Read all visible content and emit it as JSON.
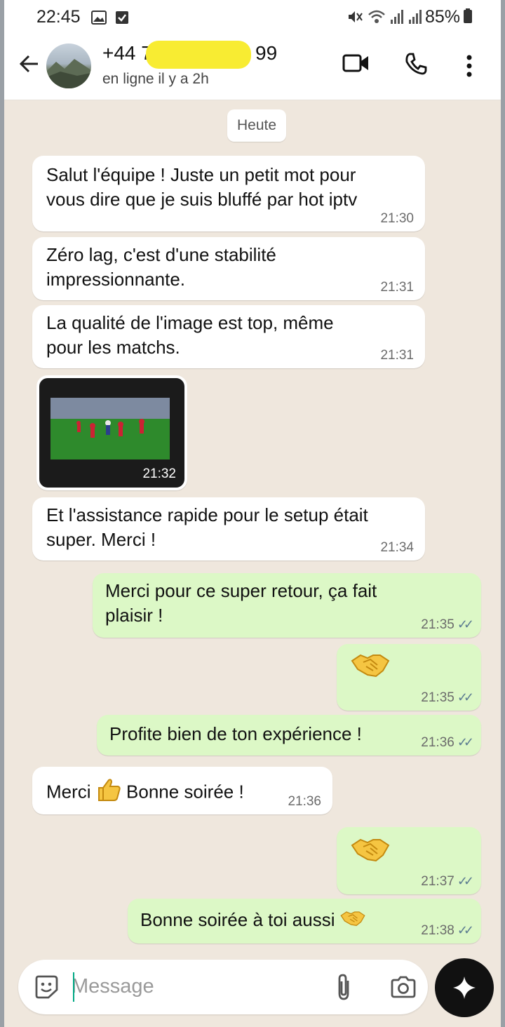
{
  "status_bar": {
    "time": "22:45",
    "battery": "85%"
  },
  "header": {
    "contact_name_visible": "+44 7",
    "contact_name_suffix": "99",
    "last_seen": "en ligne il y a 2h",
    "icons": [
      "back-arrow-icon",
      "video-call-icon",
      "phone-icon",
      "more-vert-icon"
    ]
  },
  "chat": {
    "date_chip": "Heute",
    "messages": [
      {
        "dir": "in",
        "line1": "Salut l'équipe ! Juste un petit mot pour",
        "line2": "vous dire que je suis bluffé par hot iptv",
        "time": "21:30"
      },
      {
        "dir": "in",
        "line1": "Zéro lag, c'est d'une stabilité",
        "line2": "impressionnante.",
        "time": "21:31"
      },
      {
        "dir": "in",
        "line1": "La qualité de l'image est top, même",
        "line2": "pour les matchs.",
        "time": "21:31"
      },
      {
        "dir": "in",
        "type": "image",
        "time": "21:32"
      },
      {
        "dir": "in",
        "line1": "Et l'assistance rapide pour le setup était",
        "line2": "super. Merci !",
        "time": "21:34"
      },
      {
        "dir": "out",
        "line1": "Merci pour ce super retour, ça fait",
        "line2": "plaisir !",
        "time": "21:35"
      },
      {
        "dir": "out",
        "type": "emoji",
        "emoji": "handshake",
        "time": "21:35"
      },
      {
        "dir": "out",
        "text": "Profite bien de ton expérience !",
        "time": "21:36"
      },
      {
        "dir": "in",
        "text_a": "Merci",
        "emoji": "thumbs-up",
        "text_b": "Bonne soirée !",
        "time": "21:36"
      },
      {
        "dir": "out",
        "type": "emoji",
        "emoji": "handshake",
        "time": "21:37"
      },
      {
        "dir": "out",
        "text": "Bonne soirée à toi aussi",
        "emoji": "handshake",
        "time": "21:38"
      }
    ]
  },
  "input": {
    "placeholder": "Message"
  },
  "colors": {
    "incoming": "#ffffff",
    "outgoing": "#dcf8c6",
    "chat_bg": "#efe7dd",
    "read_ticks": "#5c7c91"
  }
}
